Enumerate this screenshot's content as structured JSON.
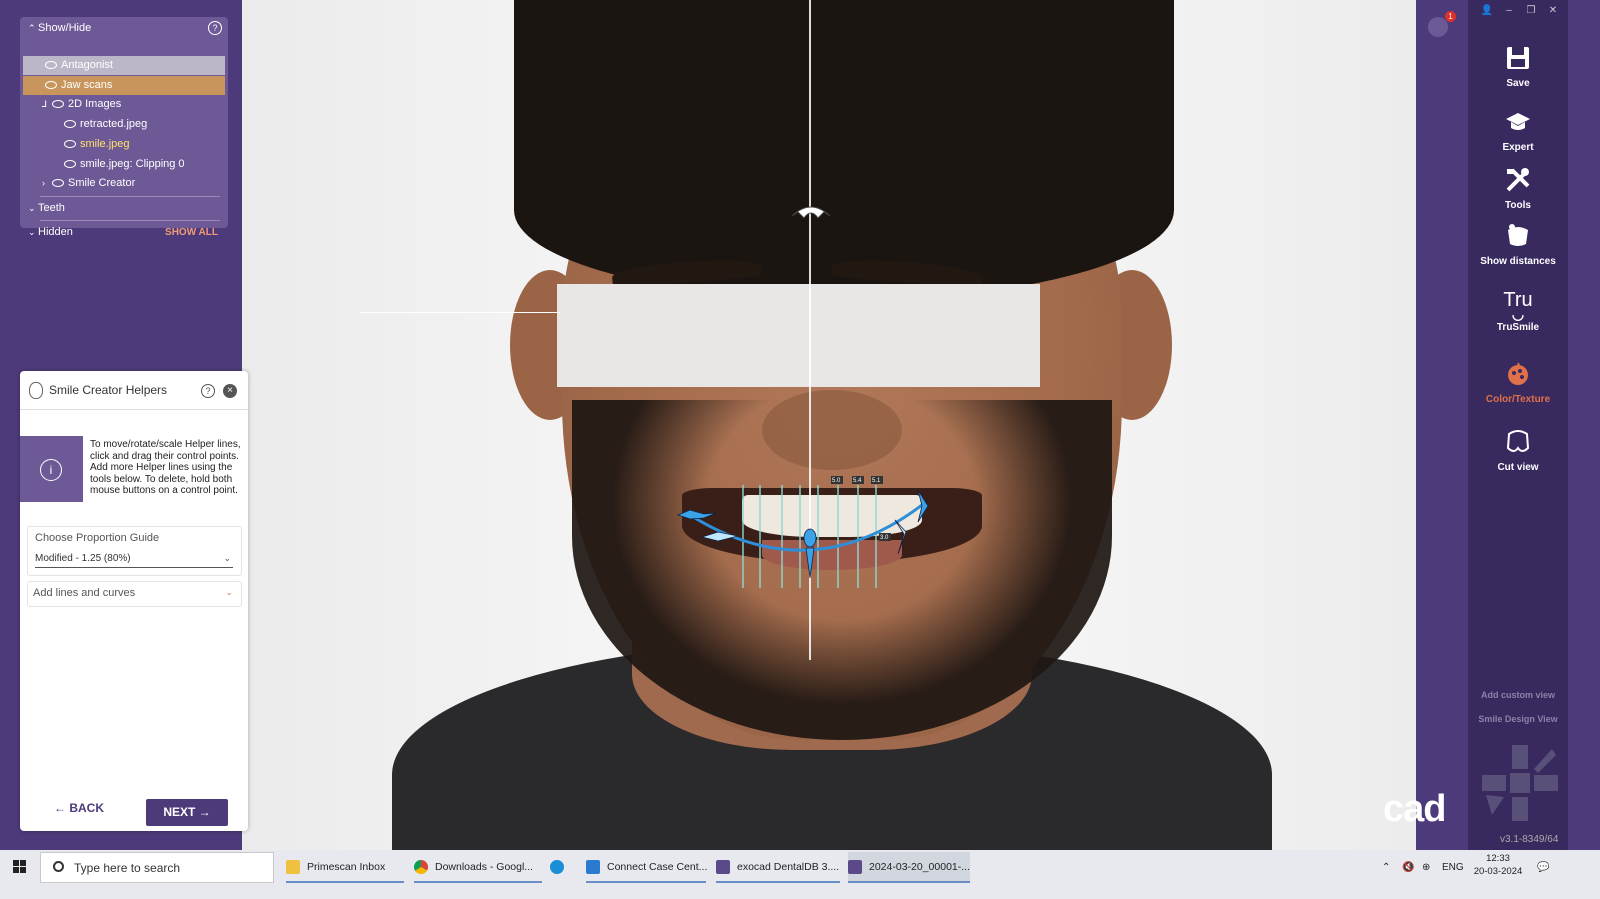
{
  "show_hide": {
    "title": "Show/Hide",
    "items": [
      "Antagonist",
      "Jaw scans",
      "2D Images",
      "retracted.jpeg",
      "smile.jpeg",
      "smile.jpeg: Clipping 0",
      "Smile Creator"
    ],
    "teeth": "Teeth",
    "hidden": "Hidden",
    "show_all": "SHOW ALL"
  },
  "helper_panel": {
    "title": "Smile Creator Helpers",
    "info": "To move/rotate/scale Helper lines, click and drag their control points. Add more Helper lines using the tools below. To delete, hold both mouse buttons on a control point.",
    "proportion_label": "Choose Proportion Guide",
    "proportion_value": "Modified - 1.25 (80%)",
    "add_lines": "Add lines and curves",
    "back": "BACK",
    "next": "NEXT"
  },
  "notifications": {
    "count": "1"
  },
  "toolbar": {
    "items": [
      "Save",
      "Expert",
      "Tools",
      "Show distances",
      "TruSmile",
      "Color/Texture",
      "Cut view"
    ],
    "trusmile_glyph": "Tru",
    "active_color": "#e0704a",
    "add_custom_view": "Add custom view",
    "smile_design_view": "Smile Design View",
    "brand": "cad",
    "version": "v3.1-8349/64"
  },
  "measurements": [
    "5.0",
    "5.4",
    "5.1",
    "3.0"
  ],
  "taskbar": {
    "search_placeholder": "Type here to search",
    "apps": [
      "Primescan Inbox",
      "Downloads - Googl...",
      "Connect Case Cent...",
      "exocad DentalDB 3....",
      "2024-03-20_00001-..."
    ],
    "language": "ENG",
    "time": "12:33",
    "date": "20-03-2024"
  }
}
